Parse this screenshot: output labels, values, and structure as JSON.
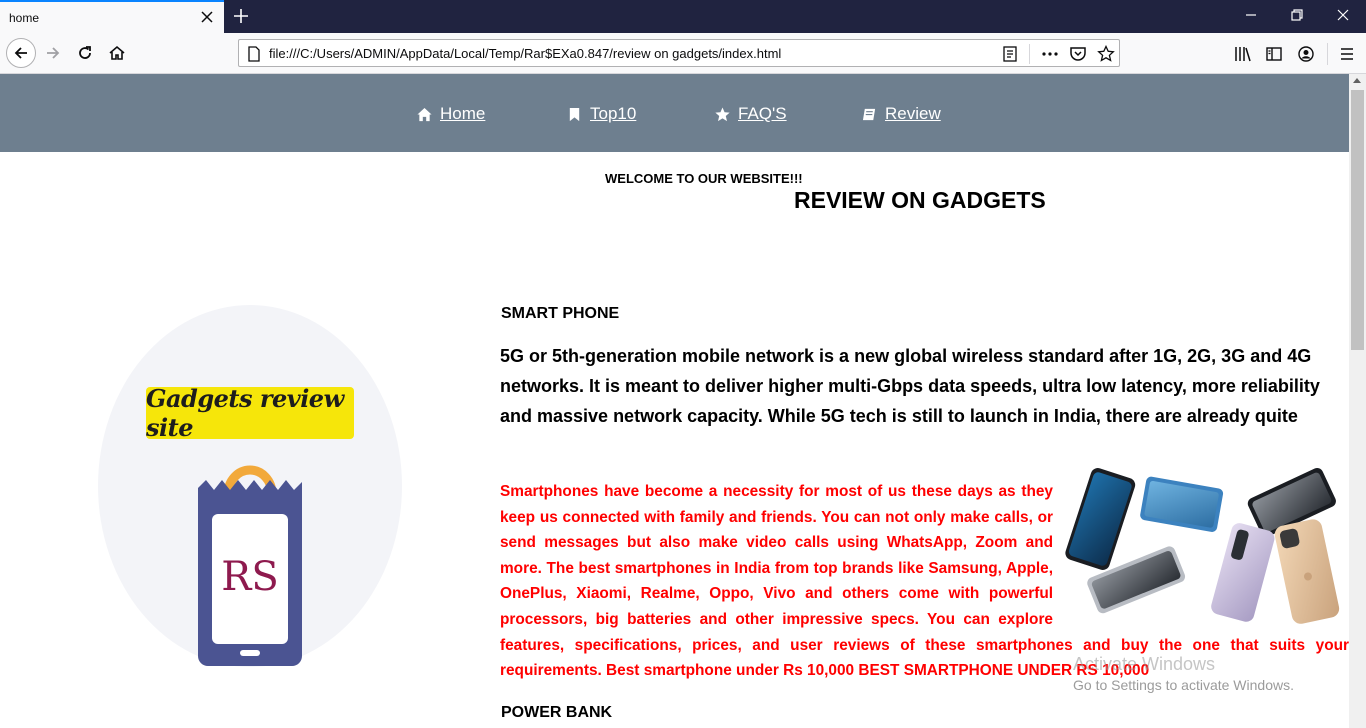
{
  "browser": {
    "tab_title": "home",
    "url": "file:///C:/Users/ADMIN/AppData/Local/Temp/Rar$EXa0.847/review on gadgets/index.html"
  },
  "site_nav": [
    {
      "label": "Home",
      "icon": "home-icon"
    },
    {
      "label": "Top10",
      "icon": "bookmark-icon"
    },
    {
      "label": "FAQ'S",
      "icon": "star-icon"
    },
    {
      "label": "Review",
      "icon": "book-icon"
    }
  ],
  "header": {
    "welcome": "WELCOME TO OUR WEBSITE!!!",
    "title": "REVIEW ON GADGETS"
  },
  "logo": {
    "banner_text": "Gadgets review site",
    "phone_text": "RS",
    "colors": {
      "banner": "#f6e60a",
      "phone": "#4b5492",
      "bag_handle": "#f2a93b",
      "rs_text": "#8e1a4e"
    }
  },
  "smartphone": {
    "heading": "SMART PHONE",
    "intro": "5G or 5th-generation mobile network is a new global wireless standard after 1G, 2G, 3G and 4G networks. It is meant to deliver higher multi-Gbps data speeds, ultra low latency, more reliability and massive network capacity. While 5G tech is still to launch in India, there are already quite",
    "details": "Smartphones have become a necessity for most of us these days as they keep us connected with family and friends. You can not only make calls, or send messages but also make video calls using WhatsApp, Zoom and more. The best smartphones in India from top brands like Samsung, Apple, OnePlus, Xiaomi, Realme, Oppo, Vivo and others come with powerful processors, big batteries and other impressive specs. You can explore features, specifications, prices, and user reviews of these smartphones and buy the one that suits your requirements. Best smartphone under Rs 10,000 BEST SMARTPHONE UNDER RS 10,000"
  },
  "power_bank": {
    "heading": "POWER BANK"
  },
  "watermark": {
    "line1": "Activate Windows",
    "line2": "Go to Settings to activate Windows."
  },
  "colors": {
    "site_nav_bg": "#6e7f8f",
    "red_text": "#ff0000",
    "tabbar_bg": "#202340"
  }
}
